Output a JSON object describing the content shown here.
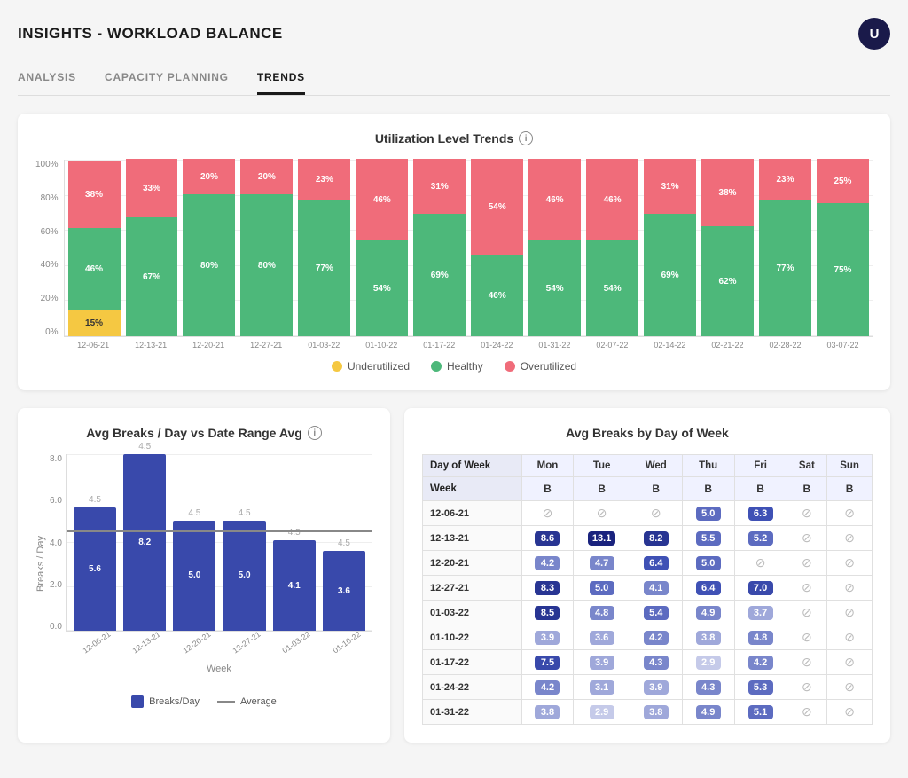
{
  "header": {
    "title": "INSIGHTS - WORKLOAD BALANCE",
    "avatar_label": "U"
  },
  "tabs": [
    {
      "id": "analysis",
      "label": "ANALYSIS",
      "active": false
    },
    {
      "id": "capacity",
      "label": "CAPACITY PLANNING",
      "active": false
    },
    {
      "id": "trends",
      "label": "TRENDS",
      "active": true
    }
  ],
  "utilization_chart": {
    "title": "Utilization Level Trends",
    "y_labels": [
      "100%",
      "80%",
      "60%",
      "40%",
      "20%",
      "0%"
    ],
    "bars": [
      {
        "label": "12-06-21",
        "under": 15,
        "healthy": 46,
        "over": 38,
        "under_label": "15%",
        "healthy_label": "46%",
        "over_label": "38%"
      },
      {
        "label": "12-13-21",
        "under": 0,
        "healthy": 67,
        "over": 33,
        "under_label": "",
        "healthy_label": "67%",
        "over_label": "33%"
      },
      {
        "label": "12-20-21",
        "under": 0,
        "healthy": 80,
        "over": 20,
        "under_label": "",
        "healthy_label": "80%",
        "over_label": "20%"
      },
      {
        "label": "12-27-21",
        "under": 0,
        "healthy": 80,
        "over": 20,
        "under_label": "",
        "healthy_label": "80%",
        "over_label": "20%"
      },
      {
        "label": "01-03-22",
        "under": 0,
        "healthy": 77,
        "over": 23,
        "under_label": "",
        "healthy_label": "77%",
        "over_label": "23%"
      },
      {
        "label": "01-10-22",
        "under": 0,
        "healthy": 54,
        "over": 46,
        "under_label": "",
        "healthy_label": "54%",
        "over_label": "46%"
      },
      {
        "label": "01-17-22",
        "under": 0,
        "healthy": 69,
        "over": 31,
        "under_label": "",
        "healthy_label": "69%",
        "over_label": "31%"
      },
      {
        "label": "01-24-22",
        "under": 0,
        "healthy": 46,
        "over": 54,
        "under_label": "",
        "healthy_label": "46%",
        "over_label": "54%"
      },
      {
        "label": "01-31-22",
        "under": 0,
        "healthy": 54,
        "over": 46,
        "under_label": "",
        "healthy_label": "54%",
        "over_label": "46%"
      },
      {
        "label": "02-07-22",
        "under": 0,
        "healthy": 54,
        "over": 46,
        "under_label": "",
        "healthy_label": "54%",
        "over_label": "46%"
      },
      {
        "label": "02-14-22",
        "under": 0,
        "healthy": 69,
        "over": 31,
        "under_label": "",
        "healthy_label": "69%",
        "over_label": "31%"
      },
      {
        "label": "02-21-22",
        "under": 0,
        "healthy": 62,
        "over": 38,
        "under_label": "",
        "healthy_label": "62%",
        "over_label": "38%"
      },
      {
        "label": "02-28-22",
        "under": 0,
        "healthy": 77,
        "over": 23,
        "under_label": "",
        "healthy_label": "77%",
        "over_label": "23%"
      },
      {
        "label": "03-07-22",
        "under": 0,
        "healthy": 75,
        "over": 25,
        "under_label": "",
        "healthy_label": "75%",
        "over_label": "25%"
      }
    ],
    "legend": [
      {
        "label": "Underutilized",
        "color": "#f5c842"
      },
      {
        "label": "Healthy",
        "color": "#4db87a"
      },
      {
        "label": "Overutilized",
        "color": "#f06c7a"
      }
    ]
  },
  "breaks_day_chart": {
    "title": "Avg Breaks / Day vs Date Range Avg",
    "y_labels": [
      "8.0",
      "6.0",
      "4.0",
      "2.0",
      "0.0"
    ],
    "avg_line_pct": 56,
    "avg_value": 4.5,
    "bars": [
      {
        "label": "12-06-21",
        "value": 5.6,
        "avg_label": "4.5",
        "height_pct": 70
      },
      {
        "label": "12-13-21",
        "value": 8.2,
        "avg_label": "4.5",
        "height_pct": 100
      },
      {
        "label": "12-20-21",
        "value": 5.0,
        "avg_label": "4.5",
        "height_pct": 62
      },
      {
        "label": "12-27-21",
        "value": 5.0,
        "avg_label": "4.5",
        "height_pct": 62
      },
      {
        "label": "01-03-22",
        "value": 4.1,
        "avg_label": "4.5",
        "height_pct": 51
      },
      {
        "label": "01-10-22",
        "value": 3.6,
        "avg_label": "4.5",
        "height_pct": 45
      }
    ],
    "x_title": "Week",
    "y_title": "Breaks / Day",
    "legend_bar": "Breaks/Day",
    "legend_line": "Average"
  },
  "breaks_dow_table": {
    "title": "Avg Breaks by Day of Week",
    "col_headers": [
      "Day of Week",
      "Mon",
      "Tue",
      "Wed",
      "Thu",
      "Fri",
      "Sat",
      "Sun"
    ],
    "sub_headers": [
      "Week",
      "B",
      "B",
      "B",
      "B",
      "B",
      "B",
      "B"
    ],
    "rows": [
      {
        "week": "12-06-21",
        "mon": null,
        "tue": null,
        "wed": null,
        "thu": "5.0",
        "fri": "6.3",
        "sat": null,
        "sun": null
      },
      {
        "week": "12-13-21",
        "mon": "8.6",
        "tue": "13.1",
        "wed": "8.2",
        "thu": "5.5",
        "fri": "5.2",
        "sat": null,
        "sun": null
      },
      {
        "week": "12-20-21",
        "mon": "4.2",
        "tue": "4.7",
        "wed": "6.4",
        "thu": "5.0",
        "fri": null,
        "sat": null,
        "sun": null
      },
      {
        "week": "12-27-21",
        "mon": "8.3",
        "tue": "5.0",
        "wed": "4.1",
        "thu": "6.4",
        "fri": "7.0",
        "sat": null,
        "sun": null
      },
      {
        "week": "01-03-22",
        "mon": "8.5",
        "tue": "4.8",
        "wed": "5.4",
        "thu": "4.9",
        "fri": "3.7",
        "sat": null,
        "sun": null
      },
      {
        "week": "01-10-22",
        "mon": "3.9",
        "tue": "3.6",
        "wed": "4.2",
        "thu": "3.8",
        "fri": "4.8",
        "sat": null,
        "sun": null
      },
      {
        "week": "01-17-22",
        "mon": "7.5",
        "tue": "3.9",
        "wed": "4.3",
        "thu": "2.9",
        "fri": "4.2",
        "sat": null,
        "sun": null
      },
      {
        "week": "01-24-22",
        "mon": "4.2",
        "tue": "3.1",
        "wed": "3.9",
        "thu": "4.3",
        "fri": "5.3",
        "sat": null,
        "sun": null
      },
      {
        "week": "01-31-22",
        "mon": "3.8",
        "tue": "2.9",
        "wed": "3.8",
        "thu": "4.9",
        "fri": "5.1",
        "sat": null,
        "sun": null
      }
    ]
  }
}
